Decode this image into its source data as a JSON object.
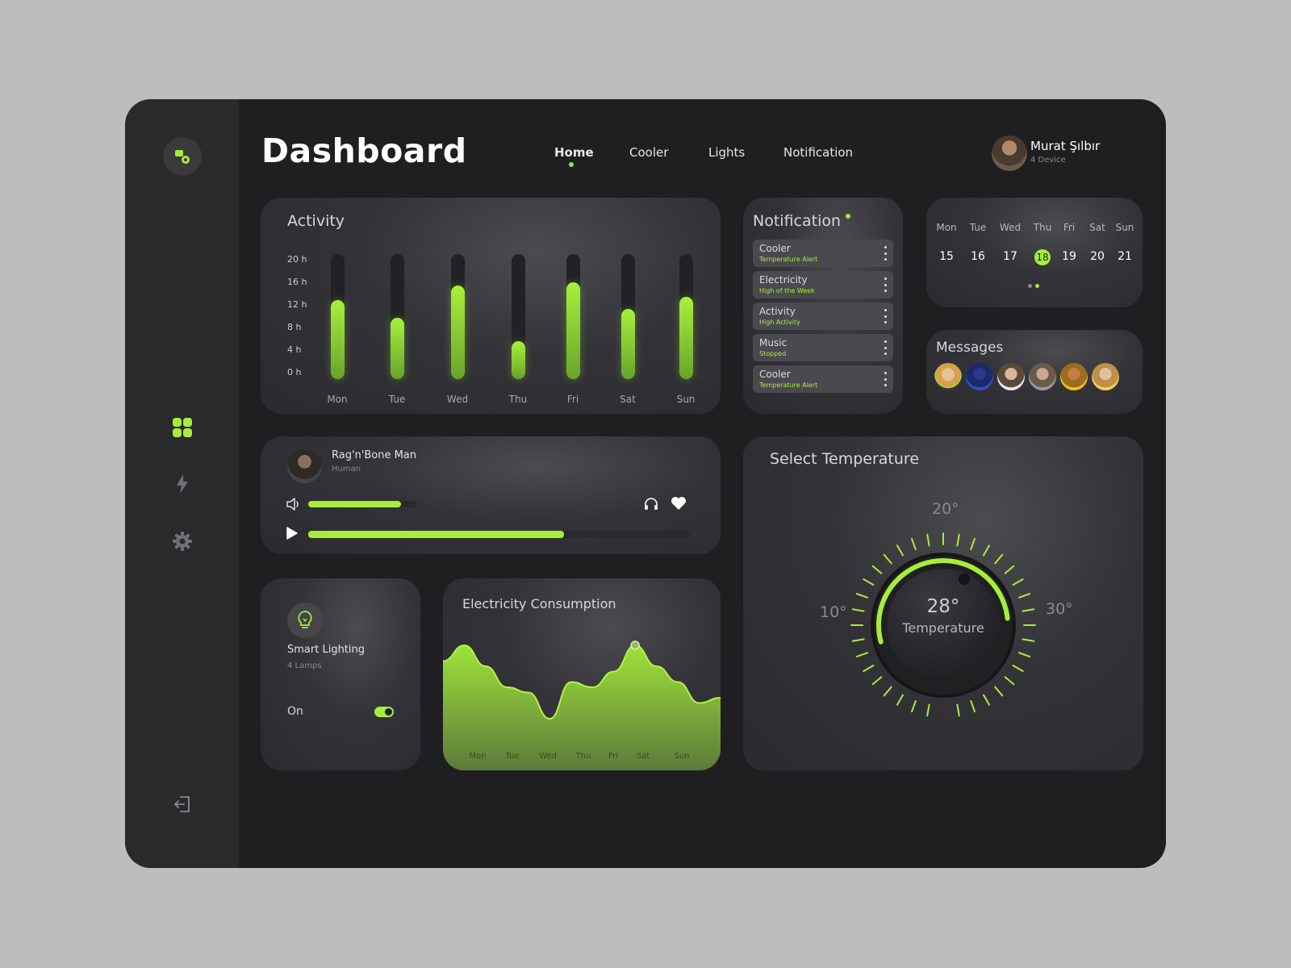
{
  "header": {
    "title": "Dashboard",
    "nav": [
      "Home",
      "Cooler",
      "Lights",
      "Notification"
    ],
    "active_nav": "Home",
    "user": {
      "name": "Murat Şılbır",
      "devices": "4 Device"
    }
  },
  "sidebar": {
    "icons": [
      "devices-logo-icon",
      "dashboard-grid-icon",
      "lightning-icon",
      "gear-icon",
      "logout-icon"
    ]
  },
  "activity": {
    "title": "Activity",
    "y_labels": [
      "20 h",
      "16 h",
      "12 h",
      "8 h",
      "4 h",
      "0 h"
    ],
    "chart_data": {
      "type": "bar",
      "title": "Activity",
      "categories": [
        "Mon",
        "Tue",
        "Wed",
        "Thu",
        "Fri",
        "Sat",
        "Sun"
      ],
      "values": [
        13.5,
        10.5,
        16,
        6.5,
        16.5,
        12,
        14
      ],
      "ylim": [
        0,
        20
      ],
      "y_ticks": [
        "20 h",
        "16 h",
        "12 h",
        "8 h",
        "4 h",
        "0 h"
      ],
      "colors": {
        "fill": "#a6ee3a",
        "track": "#222225"
      }
    }
  },
  "notification": {
    "title": "Notification",
    "items": [
      {
        "title": "Cooler",
        "subtitle": "Temperature Alert"
      },
      {
        "title": "Electricity",
        "subtitle": "High of the Week"
      },
      {
        "title": "Activity",
        "subtitle": "High Activity"
      },
      {
        "title": "Music",
        "subtitle": "Stopped"
      },
      {
        "title": "Cooler",
        "subtitle": "Temperature Alert"
      }
    ]
  },
  "calendar": {
    "days": [
      "Mon",
      "Tue",
      "Wed",
      "Thu",
      "Fri",
      "Sat",
      "Sun"
    ],
    "dates": [
      "15",
      "16",
      "17",
      "18",
      "19",
      "20",
      "21"
    ],
    "selected": "18"
  },
  "messages": {
    "title": "Messages",
    "avatars": [
      "avatar-1",
      "avatar-2",
      "avatar-3",
      "avatar-4",
      "avatar-5",
      "avatar-6"
    ]
  },
  "music": {
    "title": "Rag'n'Bone Man",
    "artist": "Human",
    "volume": 0.85,
    "progress": 0.67
  },
  "lighting": {
    "title": "Smart Lighting",
    "subtitle": "4 Lamps",
    "state": "On",
    "enabled": true
  },
  "electricity": {
    "title": "Electricity Consumption",
    "chart_data": {
      "type": "area",
      "title": "Electricity Consumption",
      "categories": [
        "Mon",
        "Tue",
        "Wed",
        "Thu",
        "Fri",
        "Sat",
        "Sun"
      ],
      "x": [
        0,
        0.5,
        1,
        1.5,
        2,
        2.5,
        3,
        3.5,
        4,
        4.5,
        5,
        5.5,
        6,
        6.5
      ],
      "values": [
        75,
        90,
        70,
        50,
        45,
        20,
        55,
        50,
        65,
        90,
        70,
        55,
        35,
        40
      ],
      "ylim": [
        0,
        100
      ],
      "highlight_index": 9,
      "colors": {
        "fill": "#a6ee3a"
      }
    }
  },
  "temperature": {
    "title": "Select Temperature",
    "min_label": "10°",
    "mid_label": "20°",
    "max_label": "30°",
    "value": "28°",
    "label": "Temperature",
    "range": [
      10,
      30
    ],
    "current": 28
  }
}
